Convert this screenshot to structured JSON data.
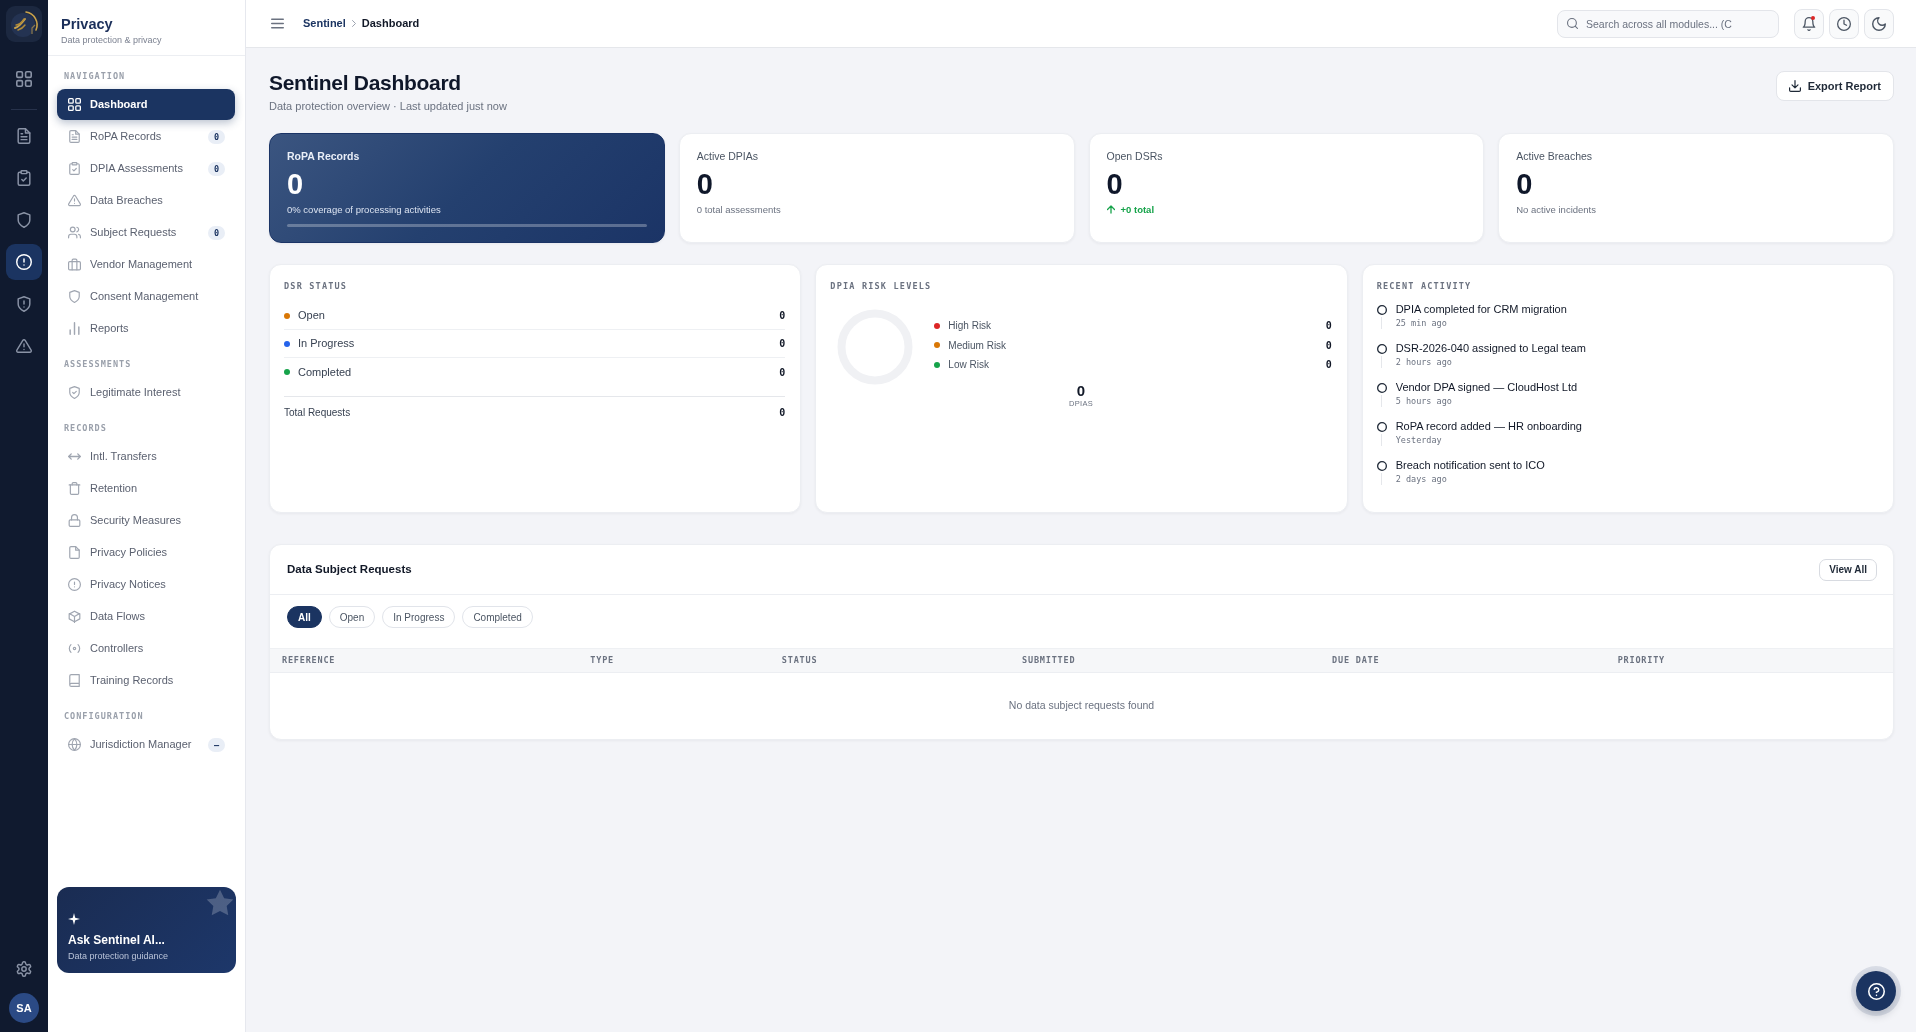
{
  "rail": {
    "items": [
      {
        "selected": false
      },
      {
        "selected": false
      },
      {
        "selected": false
      },
      {
        "selected": false
      },
      {
        "selected": true
      },
      {
        "selected": false
      },
      {
        "selected": false
      }
    ],
    "avatar": "SA"
  },
  "sidebar": {
    "title": "Privacy",
    "subtitle": "Data protection & privacy",
    "sections": [
      {
        "heading": "NAVIGATION",
        "items": [
          {
            "label": "Dashboard",
            "selected": true
          },
          {
            "label": "RoPA Records",
            "selected": false,
            "badge": "0"
          },
          {
            "label": "DPIA Assessments",
            "selected": false,
            "badge": "0"
          },
          {
            "label": "Data Breaches",
            "selected": false
          },
          {
            "label": "Subject Requests",
            "selected": false,
            "badge": "0"
          },
          {
            "label": "Vendor Management",
            "selected": false
          },
          {
            "label": "Consent Management",
            "selected": false
          },
          {
            "label": "Reports",
            "selected": false
          }
        ]
      },
      {
        "heading": "ASSESSMENTS",
        "items": [
          {
            "label": "Legitimate Interest",
            "selected": false
          }
        ]
      },
      {
        "heading": "RECORDS",
        "items": [
          {
            "label": "Intl. Transfers",
            "selected": false
          },
          {
            "label": "Retention",
            "selected": false
          },
          {
            "label": "Security Measures",
            "selected": false
          },
          {
            "label": "Privacy Policies",
            "selected": false
          },
          {
            "label": "Privacy Notices",
            "selected": false
          },
          {
            "label": "Data Flows",
            "selected": false
          },
          {
            "label": "Controllers",
            "selected": false
          },
          {
            "label": "Training Records",
            "selected": false
          }
        ]
      },
      {
        "heading": "CONFIGURATION",
        "items": [
          {
            "label": "Jurisdiction Manager",
            "selected": false,
            "badge": "–"
          }
        ]
      }
    ],
    "assistant": {
      "title": "Ask Sentinel AI...",
      "subtitle": "Data protection guidance"
    }
  },
  "topbar": {
    "breadcrumb": [
      "Sentinel",
      "Dashboard"
    ],
    "search": {
      "placeholder": "Search across all modules... (C"
    },
    "notifications_unread": true
  },
  "header": {
    "title": "Sentinel Dashboard",
    "subtitle": "Data protection overview · Last updated just now",
    "export_button": "Export Report"
  },
  "stats": [
    {
      "kind": "featured",
      "label": "RoPA Records",
      "value": "0",
      "note": "0% coverage of processing activities",
      "level": 0
    },
    {
      "kind": "plain",
      "label": "Active DPIAs",
      "value": "0",
      "note": "0 total assessments"
    },
    {
      "kind": "trend",
      "label": "Open DSRs",
      "value": "0",
      "note": "+0 total"
    },
    {
      "kind": "plain",
      "label": "Active Breaches",
      "value": "0",
      "note": "No active incidents"
    }
  ],
  "dsr_status": {
    "heading": "DSR STATUS",
    "rows": [
      {
        "label": "Open",
        "count": "0",
        "color": "#d97706"
      },
      {
        "label": "In Progress",
        "count": "0",
        "color": "#2563eb"
      },
      {
        "label": "Completed",
        "count": "0",
        "color": "#16a34a"
      }
    ],
    "total": {
      "label": "Total Requests",
      "count": "0"
    }
  },
  "dpia_risk_levels": {
    "heading": "DPIA RISK LEVELS",
    "legend": [
      {
        "label": "High Risk",
        "count": "0",
        "color": "#dc2626"
      },
      {
        "label": "Medium Risk",
        "count": "0",
        "color": "#d97706"
      },
      {
        "label": "Low Risk",
        "count": "0",
        "color": "#16a34a"
      }
    ],
    "total": "0",
    "total_label": "DPIAS"
  },
  "recent_activity": {
    "heading": "RECENT ACTIVITY",
    "items": [
      {
        "text": "DPIA completed for CRM migration",
        "time": "25 min ago"
      },
      {
        "text": "DSR-2026-040 assigned to Legal team",
        "time": "2 hours ago"
      },
      {
        "text": "Vendor DPA signed — CloudHost Ltd",
        "time": "5 hours ago"
      },
      {
        "text": "RoPA record added — HR onboarding",
        "time": "Yesterday"
      },
      {
        "text": "Breach notification sent to ICO",
        "time": "2 days ago"
      }
    ]
  },
  "data_subject_requests": {
    "title": "Data Subject Requests",
    "view_all": "View All",
    "filters": [
      {
        "label": "All",
        "selected": true
      },
      {
        "label": "Open",
        "selected": false
      },
      {
        "label": "In Progress",
        "selected": false
      },
      {
        "label": "Completed",
        "selected": false
      }
    ],
    "columns": [
      "REFERENCE",
      "TYPE",
      "STATUS",
      "SUBMITTED",
      "DUE DATE",
      "PRIORITY"
    ],
    "empty_message": "No data subject requests found"
  }
}
